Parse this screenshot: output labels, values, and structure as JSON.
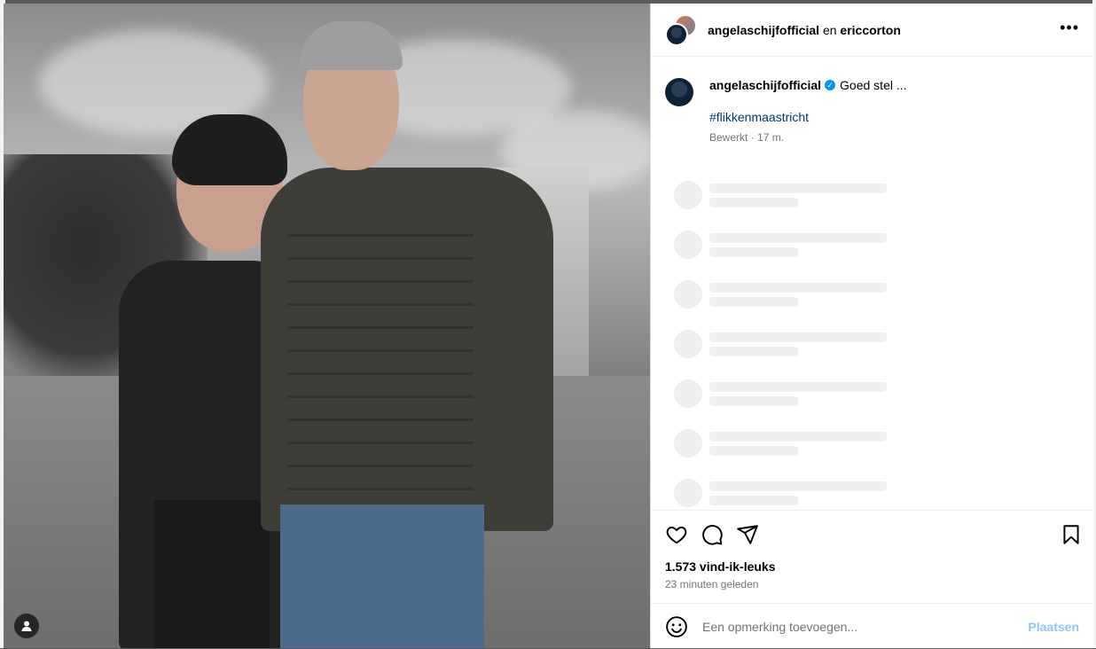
{
  "photo": {
    "alt_icon": "person-icon"
  },
  "header": {
    "user1": "angelaschijfofficial",
    "connector": "en",
    "user2": "ericcorton",
    "more_icon": "•••"
  },
  "caption": {
    "username": "angelaschijfofficial",
    "verified_icon": "✓",
    "text": "Goed stel ...",
    "hashtag": "#flikkenmaastricht",
    "edited": "Bewerkt",
    "separator": "·",
    "age": "17 m."
  },
  "stats": {
    "likes": "1.573 vind-ik-leuks",
    "posted": "23 minuten geleden"
  },
  "comment": {
    "placeholder": "Een opmerking toevoegen...",
    "post_label": "Plaatsen"
  },
  "icons": {
    "like": "heart-icon",
    "comment": "comment-icon",
    "share": "send-icon",
    "save": "bookmark-icon",
    "emoji": "emoji-icon"
  }
}
